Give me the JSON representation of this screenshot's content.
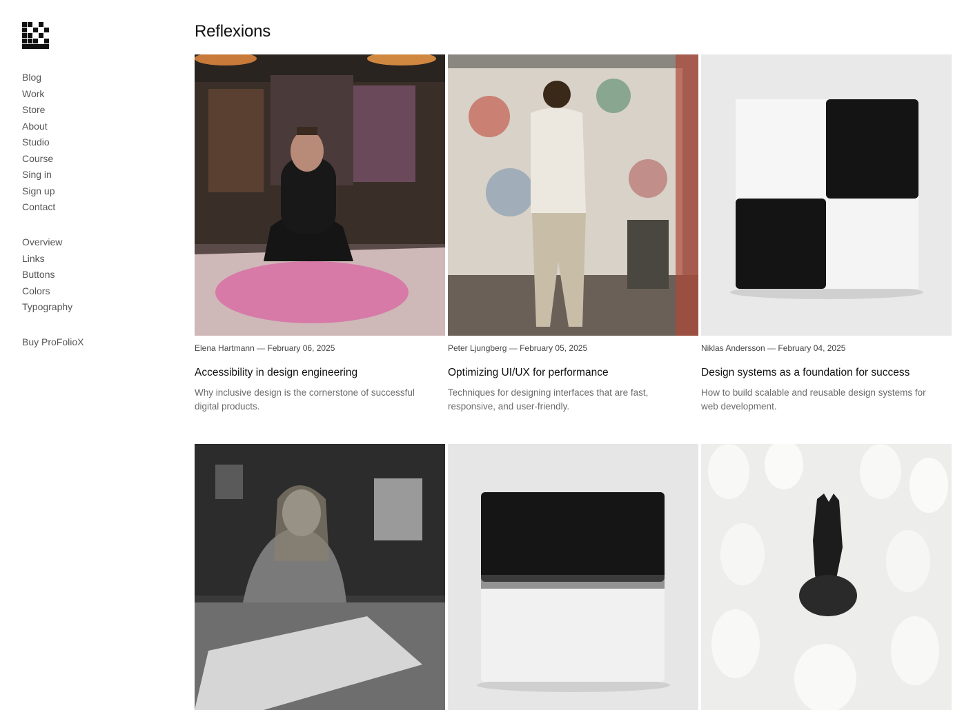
{
  "brand": {
    "logo_icon": "checkered-logo-icon"
  },
  "nav": {
    "main": [
      "Blog",
      "Work",
      "Store",
      "About",
      "Studio",
      "Course",
      "Sing in",
      "Sign up",
      "Contact"
    ],
    "secondary": [
      "Overview",
      "Links",
      "Buttons",
      "Colors",
      "Typography"
    ],
    "buy": "Buy ProFolioX"
  },
  "page": {
    "title": "Reflexions"
  },
  "posts": [
    {
      "meta": "Elena Hartmann — February 06, 2025",
      "title": "Accessibility in design engineering",
      "description": "Why inclusive design is the cornerstone of successful digital products.",
      "image": "tattooed-artist-at-table-photo"
    },
    {
      "meta": "Peter Ljungberg — February 05, 2025",
      "title": "Optimizing UI/UX for performance",
      "description": "Techniques for designing interfaces that are fast, responsive, and user-friendly.",
      "image": "painter-at-canvas-photo"
    },
    {
      "meta": "Niklas Andersson — February 04, 2025",
      "title": "Design systems as a foundation for success",
      "description": "How to build scalable and reusable design systems for web development.",
      "image": "checkered-cube-photo"
    },
    {
      "image": "woman-drawing-photo"
    },
    {
      "image": "black-white-cube-photo"
    },
    {
      "image": "black-horse-among-white-horses-photo"
    }
  ],
  "colors": {
    "text": "#1a1a1a",
    "muted": "#6b6b6b",
    "nav": "#555555",
    "background": "#ffffff"
  }
}
